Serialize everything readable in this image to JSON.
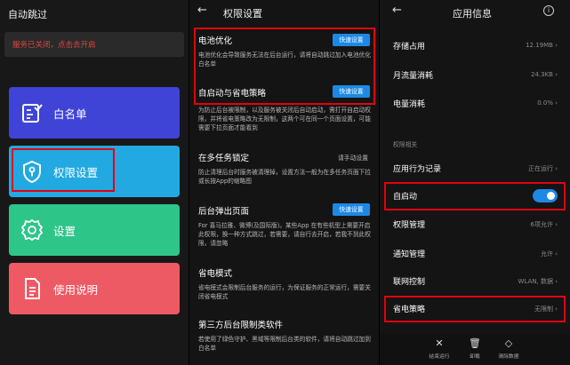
{
  "panel1": {
    "title": "自动跳过",
    "banner": "服务已关闭，点击去开启",
    "tiles": [
      {
        "label": "白名单",
        "color": "#3f44d6",
        "icon": "checklist-icon"
      },
      {
        "label": "权限设置",
        "color": "#23a9e1",
        "icon": "shield-icon"
      },
      {
        "label": "设置",
        "color": "#2ec589",
        "icon": "gear-icon"
      },
      {
        "label": "使用说明",
        "color": "#ee5a63",
        "icon": "document-icon"
      }
    ]
  },
  "panel2": {
    "back": "←",
    "title": "权限设置",
    "sections": [
      {
        "heading": "电池优化",
        "button": "快速设置",
        "desc": "电池优化会导致服务无法在后台运行，请将自动跳过加入电池优化白名单"
      },
      {
        "heading": "自启动与省电策略",
        "button": "快速设置",
        "desc": "为防止后台被限制，以及服务被关闭后自动启动，需打开自启动权限，并将省电策略改为无限制，这两个可在同一个页面设置，可能需要下拉页面才能看到"
      },
      {
        "heading": "在多任务锁定",
        "action": "请手动设置",
        "desc": "防止清理后台时服务被清理掉，设置方法一般为在多任务页面下拉或长按App的缩略图"
      },
      {
        "heading": "后台弹出页面",
        "button": "快速设置",
        "desc": "For 喜马拉雅、微博(及国际版)。某些App 在有些机型上需要开启此权限，换一种方式跳过，若需要，请自行去开启，若我不到此权限，请忽略"
      },
      {
        "heading": "省电模式",
        "desc": "省电模式会限制后台服务的运行，为保证服务的正常运行，需要关闭省电模式"
      },
      {
        "heading": "第三方后台限制类软件",
        "desc": "若使用了绿色守护、黑域等限制后台类的软件，请将自动跳过加到白名单"
      }
    ]
  },
  "panel3": {
    "back": "←",
    "title": "应用信息",
    "info": "i",
    "rows": [
      {
        "key": "存储占用",
        "value": "12.19MB"
      },
      {
        "key": "月流量消耗",
        "value": "24.3KB"
      },
      {
        "key": "电量消耗",
        "value": "0.0%"
      }
    ],
    "group_label": "权限相关",
    "perm_rows": [
      {
        "key": "应用行为记录",
        "value": "正在运行"
      },
      {
        "key": "自启动",
        "value": "",
        "toggle": true
      },
      {
        "key": "权限管理",
        "value": "6项允许"
      },
      {
        "key": "通知管理",
        "value": "允许"
      },
      {
        "key": "联网控制",
        "value": "WLAN, 数据"
      },
      {
        "key": "省电策略",
        "value": "无限制"
      }
    ],
    "bottom": [
      {
        "icon": "close-icon",
        "glyph": "✕",
        "label": "结束运行"
      },
      {
        "icon": "trash-icon",
        "glyph": "🗑",
        "label": "卸载"
      },
      {
        "icon": "eraser-icon",
        "glyph": "◇",
        "label": "清除数据"
      }
    ],
    "accent": "#1e88e5"
  },
  "highlight_color": "#e3000f"
}
